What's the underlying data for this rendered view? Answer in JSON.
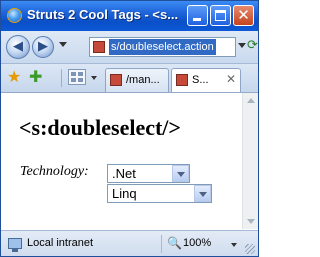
{
  "window": {
    "title": "Struts 2 Cool Tags - <s..."
  },
  "navigation": {
    "address": "s/doubleselect.action"
  },
  "tabs": [
    {
      "label": "/man..."
    },
    {
      "label": "S..."
    }
  ],
  "page": {
    "heading": "<s:doubleselect/>",
    "field_label": "Technology:",
    "first_select_value": ".Net",
    "second_select_value": "Linq"
  },
  "status": {
    "zone": "Local intranet",
    "zoom": "100%"
  },
  "colors": {
    "titlebar": "#0a4fc8",
    "selection": "#316ac5"
  }
}
